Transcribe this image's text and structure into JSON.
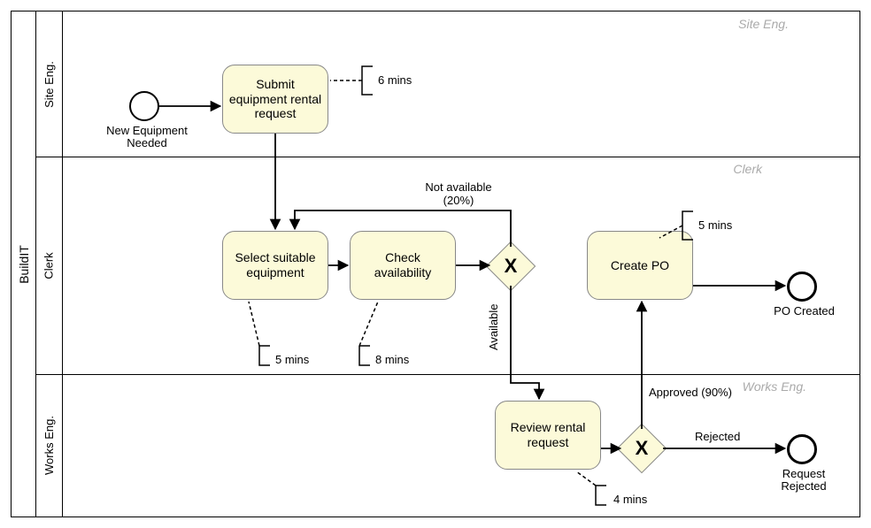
{
  "pool": "BuildIT",
  "lanes": {
    "site": "Site Eng.",
    "clerk": "Clerk",
    "works": "Works Eng."
  },
  "watermarks": {
    "site": "Site Eng.",
    "clerk": "Clerk",
    "works": "Works Eng."
  },
  "events": {
    "start_label": "New Equipment Needed",
    "end_po_label": "PO Created",
    "end_rej_label": "Request Rejected"
  },
  "tasks": {
    "submit": "Submit equipment rental request",
    "select": "Select suitable equipment",
    "check": "Check availability",
    "create_po": "Create PO",
    "review": "Review rental request"
  },
  "gateways": {
    "x": "X"
  },
  "edges": {
    "not_available": "Not available (20%)",
    "available": "Available",
    "approved": "Approved (90%)",
    "rejected": "Rejected"
  },
  "annotations": {
    "submit": "6 mins",
    "select": "5 mins",
    "check": "8 mins",
    "create_po": "5 mins",
    "review": "4 mins"
  },
  "chart_data": {
    "type": "bpmn",
    "pool": "BuildIT",
    "lanes": [
      "Site Eng.",
      "Clerk",
      "Works Eng."
    ],
    "nodes": [
      {
        "id": "start",
        "type": "start-event",
        "lane": "Site Eng.",
        "label": "New Equipment Needed"
      },
      {
        "id": "submit",
        "type": "task",
        "lane": "Site Eng.",
        "label": "Submit equipment rental request",
        "duration_min": 6
      },
      {
        "id": "select",
        "type": "task",
        "lane": "Clerk",
        "label": "Select suitable equipment",
        "duration_min": 5
      },
      {
        "id": "check",
        "type": "task",
        "lane": "Clerk",
        "label": "Check availability",
        "duration_min": 8
      },
      {
        "id": "gw_avail",
        "type": "exclusive-gateway",
        "lane": "Clerk"
      },
      {
        "id": "create_po",
        "type": "task",
        "lane": "Clerk",
        "label": "Create PO",
        "duration_min": 5
      },
      {
        "id": "end_po",
        "type": "end-event",
        "lane": "Clerk",
        "label": "PO Created"
      },
      {
        "id": "review",
        "type": "task",
        "lane": "Works Eng.",
        "label": "Review rental request",
        "duration_min": 4
      },
      {
        "id": "gw_dec",
        "type": "exclusive-gateway",
        "lane": "Works Eng."
      },
      {
        "id": "end_rej",
        "type": "end-event",
        "lane": "Works Eng.",
        "label": "Request Rejected"
      }
    ],
    "flows": [
      {
        "from": "start",
        "to": "submit"
      },
      {
        "from": "submit",
        "to": "select"
      },
      {
        "from": "select",
        "to": "check"
      },
      {
        "from": "check",
        "to": "gw_avail"
      },
      {
        "from": "gw_avail",
        "to": "select",
        "label": "Not available (20%)",
        "probability": 0.2
      },
      {
        "from": "gw_avail",
        "to": "review",
        "label": "Available"
      },
      {
        "from": "review",
        "to": "gw_dec"
      },
      {
        "from": "gw_dec",
        "to": "create_po",
        "label": "Approved (90%)",
        "probability": 0.9
      },
      {
        "from": "gw_dec",
        "to": "end_rej",
        "label": "Rejected"
      },
      {
        "from": "create_po",
        "to": "end_po"
      }
    ]
  }
}
